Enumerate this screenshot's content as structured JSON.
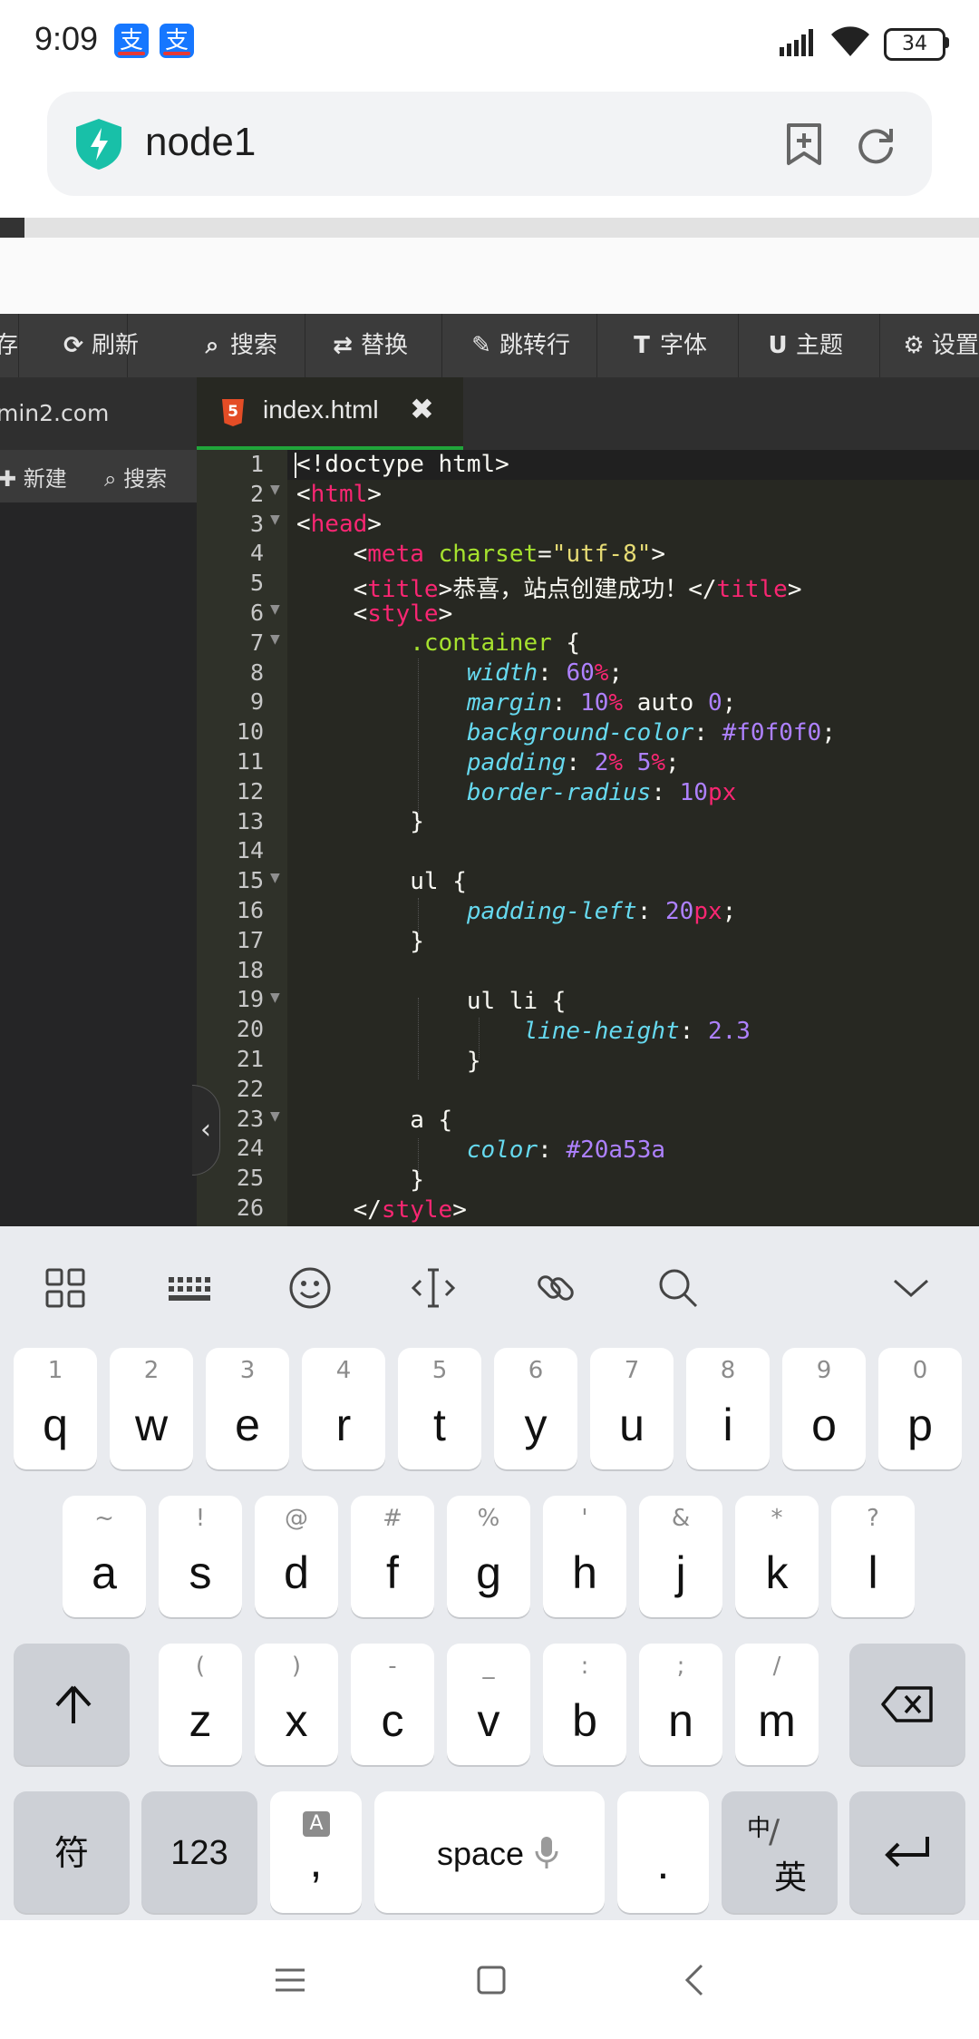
{
  "status_bar": {
    "time": "9:09",
    "pay_glyph": "支",
    "battery": "34"
  },
  "browser": {
    "title": "node1"
  },
  "toolbar": {
    "items": [
      {
        "label": "刷新",
        "icon": "refresh-icon"
      },
      {
        "label": "搜索",
        "icon": "search-icon"
      },
      {
        "label": "替换",
        "icon": "replace-icon"
      },
      {
        "label": "跳转行",
        "icon": "pin-icon"
      },
      {
        "label": "字体",
        "icon": "text-icon"
      },
      {
        "label": "主题",
        "icon": "magnet-icon"
      },
      {
        "label": "设置",
        "icon": "gear-icon"
      }
    ]
  },
  "tabs": {
    "left_tab": "min2.com",
    "active_tab": "index.html",
    "file_icon_letter": "5"
  },
  "sidebar": {
    "new_label": "新建",
    "search_label": "搜索"
  },
  "editor": {
    "line_numbers": [
      "1",
      "2",
      "3",
      "4",
      "5",
      "6",
      "7",
      "8",
      "9",
      "10",
      "11",
      "12",
      "13",
      "14",
      "15",
      "16",
      "17",
      "18",
      "19",
      "20",
      "21",
      "22",
      "23",
      "24",
      "25",
      "26"
    ],
    "lines": {
      "l1": "<!doctype html>",
      "l2_open": "<",
      "l2_tag": "html",
      "l2_close": ">",
      "l3_tag": "head",
      "l4_tag": "meta",
      "l4_attr": "charset",
      "l4_val": "\"utf-8\"",
      "l5_tag": "title",
      "l5_text": "恭喜，站点创建成功！",
      "l6_tag": "style",
      "l7_sel": ".container",
      "l8_prop": "width",
      "l8_num": "60",
      "l8_unit": "%",
      "l9_prop": "margin",
      "l9_num1": "10",
      "l9_unit": "%",
      "l9_rest": "auto",
      "l9_num2": "0",
      "l10_prop": "background-color",
      "l10_val": "#f0f0f0",
      "l11_prop": "padding",
      "l11_num1": "2",
      "l11_num2": "5",
      "l12_prop": "border-radius",
      "l12_num": "10",
      "l12_unit": "px",
      "l15_sel": "ul",
      "l16_prop": "padding-left",
      "l16_num": "20",
      "l16_unit": "px",
      "l19_sel": "ul li",
      "l20_prop": "line-height",
      "l20_num": "2.3",
      "l23_sel": "a",
      "l24_prop": "color",
      "l24_val": "#20a53a",
      "l26_tag": "style"
    }
  },
  "keyboard": {
    "row1": [
      {
        "k": "q",
        "h": "1"
      },
      {
        "k": "w",
        "h": "2"
      },
      {
        "k": "e",
        "h": "3"
      },
      {
        "k": "r",
        "h": "4"
      },
      {
        "k": "t",
        "h": "5"
      },
      {
        "k": "y",
        "h": "6"
      },
      {
        "k": "u",
        "h": "7"
      },
      {
        "k": "i",
        "h": "8"
      },
      {
        "k": "o",
        "h": "9"
      },
      {
        "k": "p",
        "h": "0"
      }
    ],
    "row2": [
      {
        "k": "a",
        "h": "~"
      },
      {
        "k": "s",
        "h": "!"
      },
      {
        "k": "d",
        "h": "@"
      },
      {
        "k": "f",
        "h": "#"
      },
      {
        "k": "g",
        "h": "%"
      },
      {
        "k": "h",
        "h": "'"
      },
      {
        "k": "j",
        "h": "&"
      },
      {
        "k": "k",
        "h": "*"
      },
      {
        "k": "l",
        "h": "?"
      }
    ],
    "row3": [
      {
        "k": "z",
        "h": "("
      },
      {
        "k": "x",
        "h": ")"
      },
      {
        "k": "c",
        "h": "-"
      },
      {
        "k": "v",
        "h": "_"
      },
      {
        "k": "b",
        "h": ":"
      },
      {
        "k": "n",
        "h": ";"
      },
      {
        "k": "m",
        "h": "/"
      }
    ],
    "symbols_label": "符",
    "numbers_label": "123",
    "comma_label": ",",
    "comma_hint": "A",
    "space_label": "space",
    "period_label": ".",
    "lang_top": "中",
    "lang_bottom": "英"
  },
  "colors": {
    "accent_green": "#20a53a",
    "editor_bg": "#272822",
    "keyboard_bg": "#e9ebef"
  }
}
